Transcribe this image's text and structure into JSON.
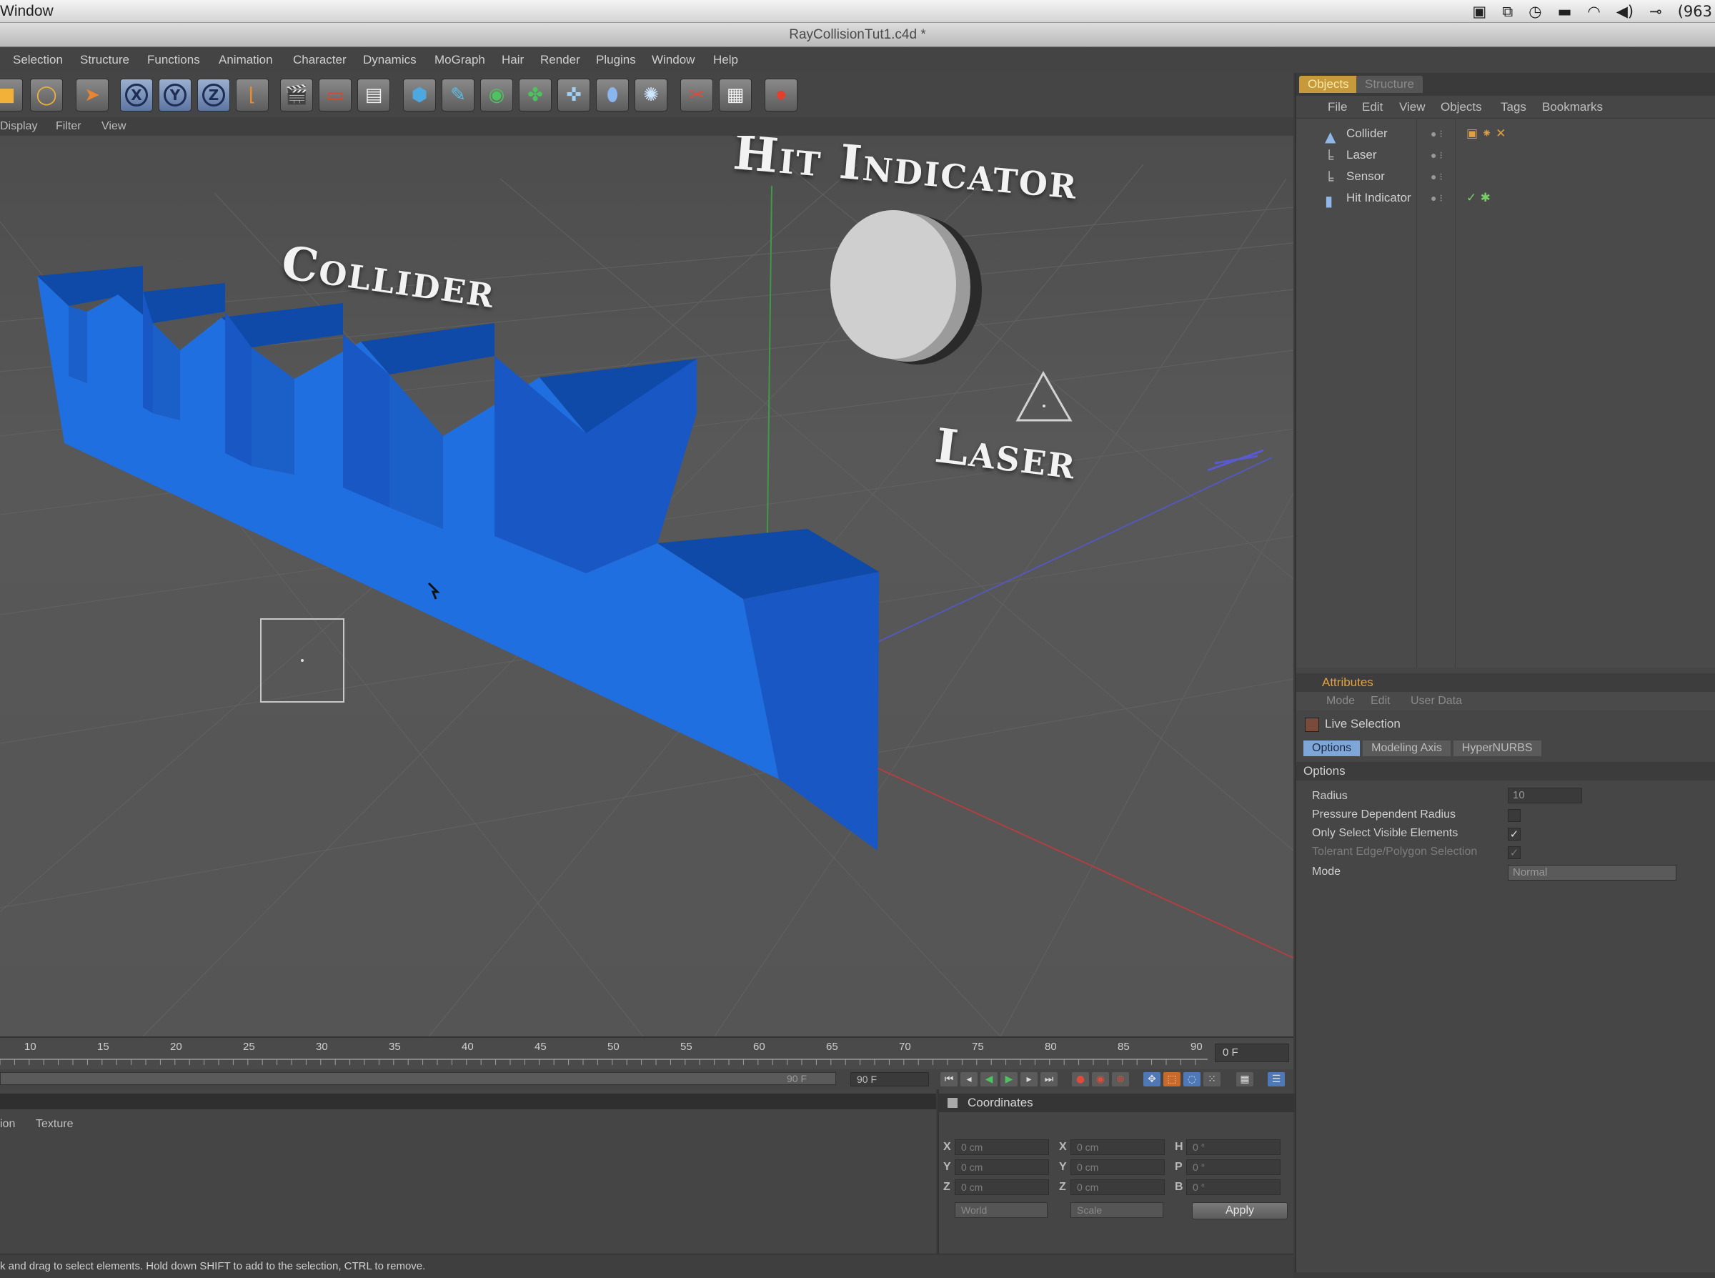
{
  "os_menubar": {
    "app_menu": "Window",
    "tray": [
      "▣",
      "⧉",
      "◷",
      "▬",
      "◠",
      "◀)",
      "⊸",
      "(963"
    ]
  },
  "window": {
    "title": "RayCollisionTut1.c4d *"
  },
  "menubar": [
    "Selection",
    "Structure",
    "Functions",
    "Animation",
    "Character",
    "Dynamics",
    "MoGraph",
    "Hair",
    "Render",
    "Plugins",
    "Window",
    "Help"
  ],
  "toolbar": {
    "icons": [
      "move-icon",
      "rotate-icon",
      "select-arrow-icon",
      "x-axis-icon",
      "y-axis-icon",
      "z-axis-icon",
      "coordinate-system-icon",
      "render-view-icon",
      "render-active-icon",
      "render-settings-icon",
      "cube-primitive-icon",
      "spline-pen-icon",
      "nurbs-icon",
      "array-icon",
      "deformer-icon",
      "scene-object-icon",
      "light-icon",
      "camera-icon",
      "environment-icon",
      "record-icon"
    ],
    "axis_labels": [
      "X",
      "Y",
      "Z"
    ]
  },
  "viewport": {
    "menu": [
      "Display",
      "Filter",
      "View"
    ],
    "labels": {
      "collider": "Collider",
      "hit_indicator": "Hit Indicator",
      "laser": "Laser"
    },
    "colors": {
      "collider": "#1f6fe0",
      "collider_dark": "#0f4aa8",
      "sphere": "#cfcfcf"
    }
  },
  "object_manager": {
    "tabs": [
      "Objects",
      "Structure"
    ],
    "menu": [
      "File",
      "Edit",
      "View",
      "Objects",
      "Tags",
      "Bookmarks"
    ],
    "objects": [
      {
        "name": "Collider",
        "icon": "▲"
      },
      {
        "name": "Laser",
        "icon": "╘"
      },
      {
        "name": "Sensor",
        "icon": "╘"
      },
      {
        "name": "Hit Indicator",
        "icon": "▮"
      }
    ]
  },
  "attribute_manager": {
    "title": "Attributes",
    "menu": [
      "Mode",
      "Edit",
      "User Data"
    ],
    "mode": "Live Selection",
    "tabs": [
      "Options",
      "Modeling Axis",
      "HyperNURBS"
    ],
    "section": "Options",
    "props": [
      {
        "label": "Radius",
        "value": "10",
        "type": "field"
      },
      {
        "label": "Pressure Dependent Radius",
        "value": "",
        "type": "check"
      },
      {
        "label": "Only Select Visible Elements",
        "value": "✓",
        "type": "check"
      },
      {
        "label": "Tolerant Edge/Polygon Selection",
        "value": "✓",
        "type": "check-dim"
      },
      {
        "label": "Mode",
        "value": "Normal",
        "type": "select"
      }
    ]
  },
  "timeline": {
    "ticks": [
      "10",
      "15",
      "20",
      "25",
      "30",
      "35",
      "40",
      "45",
      "50",
      "55",
      "60",
      "65",
      "70",
      "75",
      "80",
      "85",
      "90"
    ],
    "current_frame": "0 F",
    "range_end": "90 F",
    "end_field": "90 F"
  },
  "material_manager": {
    "menu": [
      "ion",
      "Texture"
    ]
  },
  "coordinates": {
    "title": "Coordinates",
    "pos_labels": [
      "X",
      "Y",
      "Z"
    ],
    "size_labels": [
      "X",
      "Y",
      "Z"
    ],
    "rot_labels": [
      "H",
      "P",
      "B"
    ],
    "pos_values": [
      "0 cm",
      "0 cm",
      "0 cm"
    ],
    "size_values": [
      "0 cm",
      "0 cm",
      "0 cm"
    ],
    "rot_values": [
      "0 °",
      "0 °",
      "0 °"
    ],
    "select_left": "World",
    "select_right": "Scale",
    "apply": "Apply"
  },
  "status": "k and drag to select elements. Hold down SHIFT to add to the selection, CTRL to remove."
}
